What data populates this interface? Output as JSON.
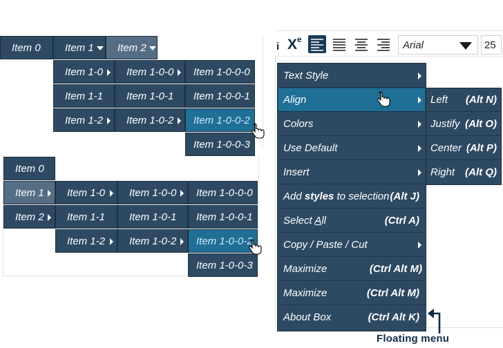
{
  "menu_a": {
    "top": [
      "Item 0",
      "Item 1",
      "Item 2"
    ],
    "col1": [
      "Item 1-0",
      "Item 1-1",
      "Item 1-2"
    ],
    "col2": [
      "Item 1-0-0",
      "Item 1-0-1",
      "Item 1-0-2"
    ],
    "col3": [
      "Item 1-0-0-0",
      "Item 1-0-0-1",
      "Item 1-0-0-2",
      "Item 1-0-0-3"
    ]
  },
  "menu_b": {
    "left": [
      "Item 0",
      "Item 1",
      "Item 2"
    ],
    "col1": [
      "Item 1-0",
      "Item 1-1",
      "Item 1-2"
    ],
    "col2": [
      "Item 1-0-0",
      "Item 1-0-1",
      "Item 1-0-2"
    ],
    "col3": [
      "Item 1-0-0-0",
      "Item 1-0-0-1",
      "Item 1-0-0-2",
      "Item 1-0-0-3"
    ]
  },
  "toolbar": {
    "italic_glyph": "i",
    "superscript_base": "X",
    "superscript_exp": "e",
    "font_name": "Arial",
    "font_size": "25"
  },
  "floating_menu": {
    "items": [
      {
        "label": "Text Style",
        "shortcut": ""
      },
      {
        "label": "Align",
        "shortcut": ""
      },
      {
        "label": "Colors",
        "shortcut": ""
      },
      {
        "label": "Use Default",
        "shortcut": ""
      },
      {
        "label": "Insert",
        "shortcut": ""
      },
      {
        "label_pre": "Add ",
        "label_bold": "styles",
        "label_post": " to selection",
        "shortcut": "(Alt J)"
      },
      {
        "label_pre": "Select ",
        "label_ul": "A",
        "label_post": "ll",
        "shortcut": "(Ctrl A)"
      },
      {
        "label": "Copy / Paste / Cut",
        "shortcut": ""
      },
      {
        "label": "Maximize",
        "shortcut": "(Ctrl Alt M)"
      },
      {
        "label": "Maximize",
        "shortcut": "(Ctrl Alt M)"
      },
      {
        "label": "About Box",
        "shortcut": "(Ctrl Alt K)"
      }
    ],
    "submenu": [
      {
        "label": "Left",
        "shortcut": "(Alt N)"
      },
      {
        "label": "Justify",
        "shortcut": "(Alt O)"
      },
      {
        "label": "Center",
        "shortcut": "(Alt P)"
      },
      {
        "label": "Right",
        "shortcut": "(Alt Q)"
      }
    ],
    "caption": "Floating menu"
  },
  "colors": {
    "menu_bg": "#2e4a63",
    "highlight": "#556e83",
    "selected": "#1f6f96",
    "caption": "#0f2b44"
  }
}
